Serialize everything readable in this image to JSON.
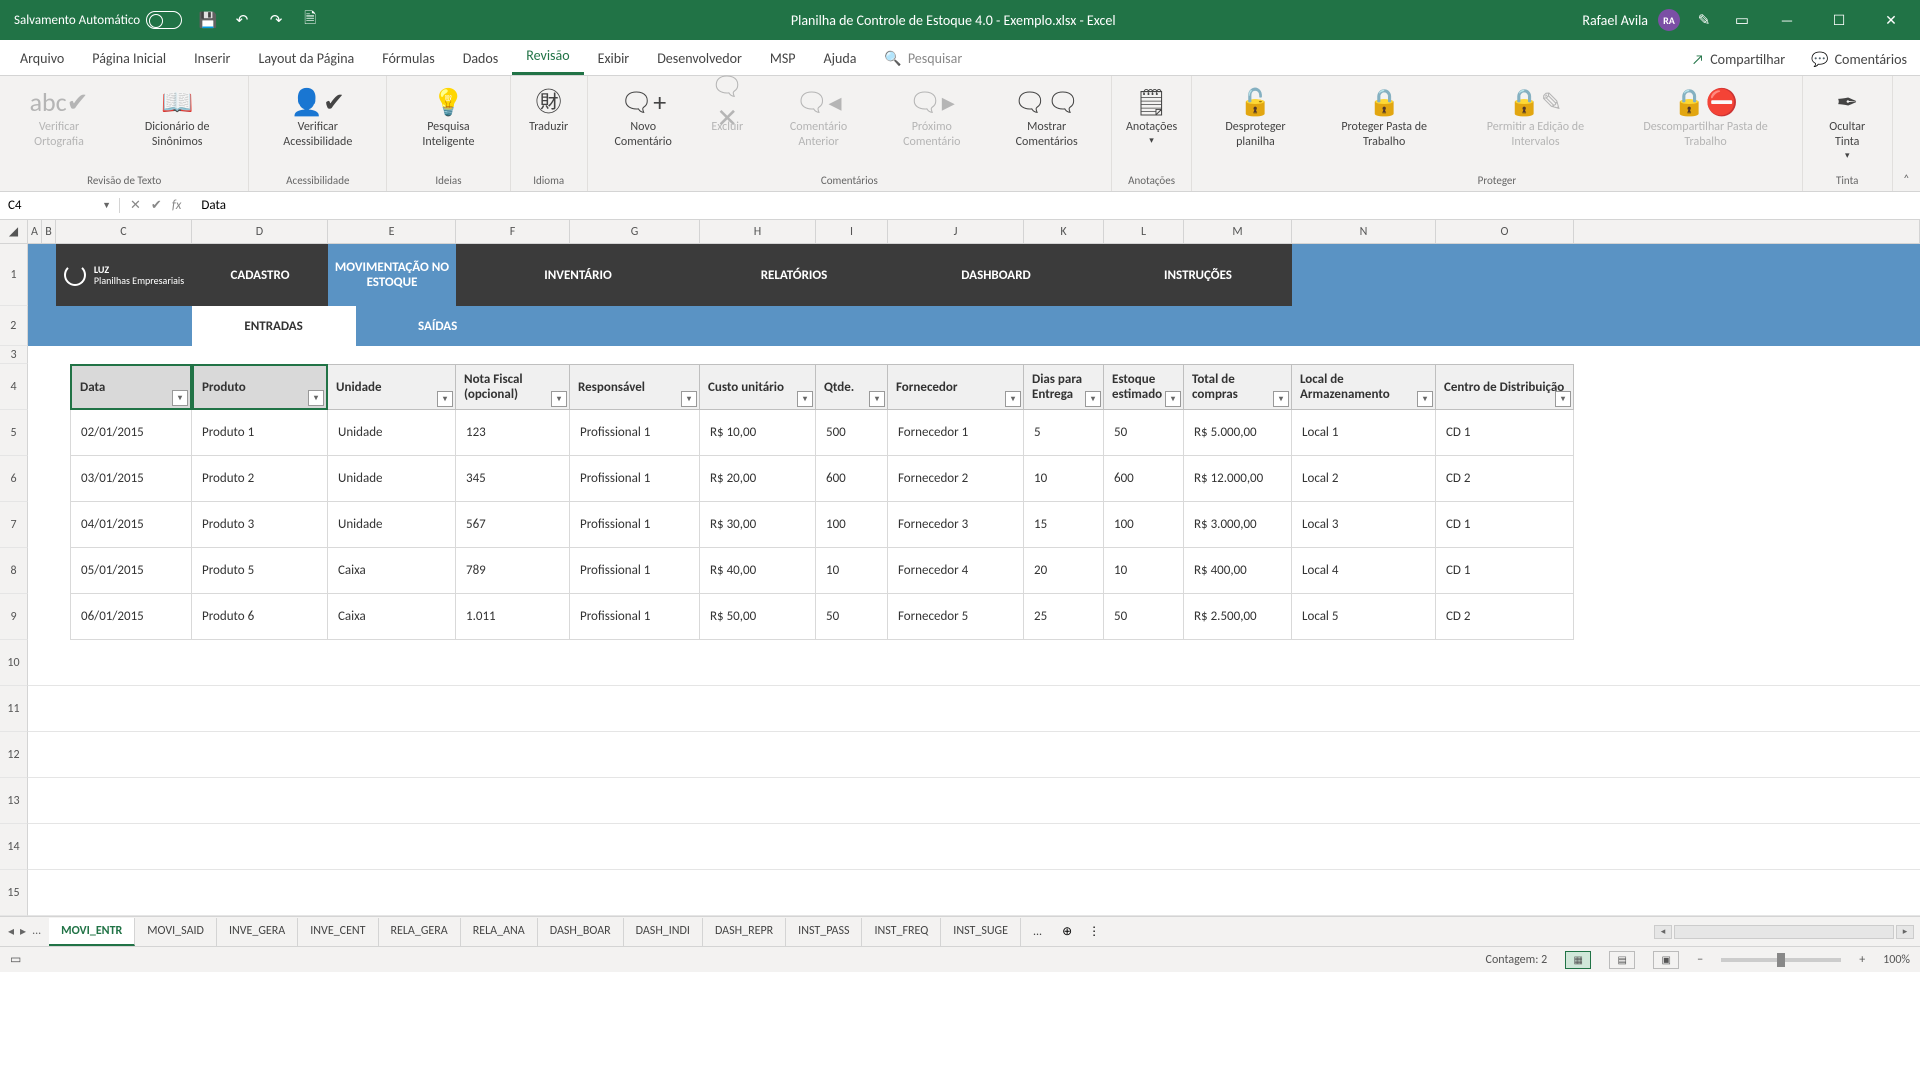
{
  "titlebar": {
    "autosave_label": "Salvamento Automático",
    "title": "Planilha de Controle de Estoque 4.0 - Exemplo.xlsx  -  Excel",
    "user_name": "Rafael Avila",
    "user_initials": "RA"
  },
  "ribbon_tabs": {
    "arquivo": "Arquivo",
    "pagina_inicial": "Página Inicial",
    "inserir": "Inserir",
    "layout": "Layout da Página",
    "formulas": "Fórmulas",
    "dados": "Dados",
    "revisao": "Revisão",
    "exibir": "Exibir",
    "desenvolvedor": "Desenvolvedor",
    "msp": "MSP",
    "ajuda": "Ajuda",
    "search": "Pesquisar",
    "compartilhar": "Compartilhar",
    "comentarios": "Comentários"
  },
  "ribbon": {
    "revisao_texto": {
      "label": "Revisão de Texto",
      "verificar_ortografia": "Verificar Ortografia",
      "dicionario": "Dicionário de Sinônimos"
    },
    "acessibilidade": {
      "label": "Acessibilidade",
      "verificar": "Verificar Acessibilidade"
    },
    "ideias": {
      "label": "Ideias",
      "pesquisa": "Pesquisa Inteligente"
    },
    "idioma": {
      "label": "Idioma",
      "traduzir": "Traduzir"
    },
    "comentarios_grp": {
      "label": "Comentários",
      "novo": "Novo Comentário",
      "excluir": "Excluir",
      "anterior": "Comentário Anterior",
      "proximo": "Próximo Comentário",
      "mostrar": "Mostrar Comentários"
    },
    "anotacoes": {
      "label": "Anotações",
      "anotacoes": "Anotações"
    },
    "proteger": {
      "label": "Proteger",
      "desproteger": "Desproteger planilha",
      "proteger_pasta": "Proteger Pasta de Trabalho",
      "permitir": "Permitir a Edição de Intervalos",
      "descompartilhar": "Descompartilhar Pasta de Trabalho"
    },
    "tinta": {
      "label": "Tinta",
      "ocultar": "Ocultar Tinta"
    }
  },
  "formula_bar": {
    "namebox": "C4",
    "value": "Data"
  },
  "columns": {
    "A": "A",
    "B": "B",
    "C": "C",
    "D": "D",
    "E": "E",
    "F": "F",
    "G": "G",
    "H": "H",
    "I": "I",
    "J": "J",
    "K": "K",
    "L": "L",
    "M": "M",
    "N": "N",
    "O": "O"
  },
  "nav": {
    "logo_line1": "LUZ",
    "logo_line2": "Planilhas Empresariais",
    "cadastro": "CADASTRO",
    "mov": "MOVIMENTAÇÃO NO ESTOQUE",
    "inv": "INVENTÁRIO",
    "rel": "RELATÓRIOS",
    "dash": "DASHBOARD",
    "inst": "INSTRUÇÕES"
  },
  "subtabs": {
    "entradas": "ENTRADAS",
    "saidas": "SAÍDAS"
  },
  "headers": {
    "data": "Data",
    "produto": "Produto",
    "unidade": "Unidade",
    "nota": "Nota Fiscal (opcional)",
    "responsavel": "Responsável",
    "custo": "Custo unitário",
    "qtde": "Qtde.",
    "fornecedor": "Fornecedor",
    "dias": "Dias para Entrega",
    "estoque": "Estoque estimado",
    "total": "Total de compras",
    "local": "Local de Armazenamento",
    "centro": "Centro de Distribuição"
  },
  "rows": [
    {
      "data": "02/01/2015",
      "produto": "Produto 1",
      "unidade": "Unidade",
      "nota": "123",
      "resp": "Profissional 1",
      "custo": "R$ 10,00",
      "qtde": "500",
      "forn": "Fornecedor 1",
      "dias": "5",
      "est": "50",
      "total": "R$ 5.000,00",
      "local": "Local 1",
      "cd": "CD 1"
    },
    {
      "data": "03/01/2015",
      "produto": "Produto 2",
      "unidade": "Unidade",
      "nota": "345",
      "resp": "Profissional 1",
      "custo": "R$ 20,00",
      "qtde": "600",
      "forn": "Fornecedor 2",
      "dias": "10",
      "est": "600",
      "total": "R$ 12.000,00",
      "local": "Local 2",
      "cd": "CD 2"
    },
    {
      "data": "04/01/2015",
      "produto": "Produto 3",
      "unidade": "Unidade",
      "nota": "567",
      "resp": "Profissional 1",
      "custo": "R$ 30,00",
      "qtde": "100",
      "forn": "Fornecedor 3",
      "dias": "15",
      "est": "100",
      "total": "R$ 3.000,00",
      "local": "Local 3",
      "cd": "CD 1"
    },
    {
      "data": "05/01/2015",
      "produto": "Produto 5",
      "unidade": "Caixa",
      "nota": "789",
      "resp": "Profissional 1",
      "custo": "R$ 40,00",
      "qtde": "10",
      "forn": "Fornecedor 4",
      "dias": "20",
      "est": "10",
      "total": "R$ 400,00",
      "local": "Local 4",
      "cd": "CD 1"
    },
    {
      "data": "06/01/2015",
      "produto": "Produto 6",
      "unidade": "Caixa",
      "nota": "1.011",
      "resp": "Profissional 1",
      "custo": "R$ 50,00",
      "qtde": "50",
      "forn": "Fornecedor 5",
      "dias": "25",
      "est": "50",
      "total": "R$ 2.500,00",
      "local": "Local 5",
      "cd": "CD 2"
    }
  ],
  "sheets": {
    "tabs": [
      "MOVI_ENTR",
      "MOVI_SAID",
      "INVE_GERA",
      "INVE_CENT",
      "RELA_GERA",
      "RELA_ANA",
      "DASH_BOAR",
      "DASH_INDI",
      "DASH_REPR",
      "INST_PASS",
      "INST_FREQ",
      "INST_SUGE"
    ],
    "more": "..."
  },
  "status": {
    "contagem": "Contagem: 2",
    "zoom": "100%"
  }
}
